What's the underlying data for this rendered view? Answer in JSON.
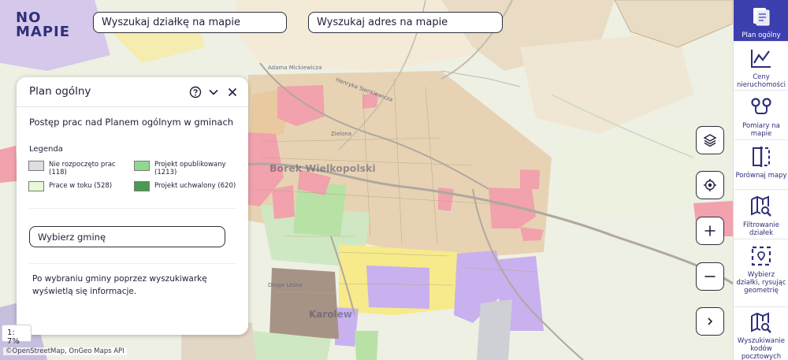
{
  "app": {
    "logo_line1": "NO",
    "logo_line2": "MAPIE"
  },
  "search": {
    "parcel_placeholder": "Wyszukaj działkę na mapie",
    "address_placeholder": "Wyszukaj adres na mapie"
  },
  "panel": {
    "title": "Plan ogólny",
    "subtitle": "Postęp prac nad Planem ogólnym w gminach",
    "legend_title": "Legenda",
    "legend": [
      {
        "line1": "Nie rozpoczęto prac",
        "line2": "(118)",
        "color": "#dedee2"
      },
      {
        "line1": "Projekt opublikowany",
        "line2": "(1213)",
        "color": "#8fd98f"
      },
      {
        "line1": "Prace w toku (528)",
        "line2": "",
        "color": "#e8f7d6"
      },
      {
        "line1": "Projekt uchwalony (620)",
        "line2": "",
        "color": "#4a9a55"
      }
    ],
    "gmina_placeholder": "Wybierz gminę",
    "info": "Po wybraniu gminy poprzez wyszukiwarkę wyświetlą się informacje."
  },
  "sidebar": {
    "items": [
      {
        "label": "Plan ogólny",
        "icon": "plan-icon"
      },
      {
        "label": "Ceny nieruchomości",
        "icon": "price-chart-icon"
      },
      {
        "label": "Pomiary na mapie",
        "icon": "measure-icon"
      },
      {
        "label": "Porównaj mapy",
        "icon": "compare-icon"
      },
      {
        "label": "Filtrowanie działek",
        "icon": "filter-map-icon"
      },
      {
        "label": "Wybierz działki, rysując geometrię",
        "icon": "draw-select-icon"
      },
      {
        "label": "Wyszukiwanie kodów pocztowych",
        "icon": "postal-search-icon"
      }
    ]
  },
  "map": {
    "scale_text": "1: 7%",
    "attribution": "©OpenStreetMap, OnGeo Maps API",
    "town_label": "Borek Wielkopolski",
    "village_label": "Karolew",
    "street_labels": [
      "Adama Mickiewicza",
      "Henryka Sienkiewicza",
      "Zielona",
      "Droga Leśna"
    ]
  },
  "colors": {
    "accent": "#3c3fae",
    "brand_text": "#2d2f7a"
  }
}
